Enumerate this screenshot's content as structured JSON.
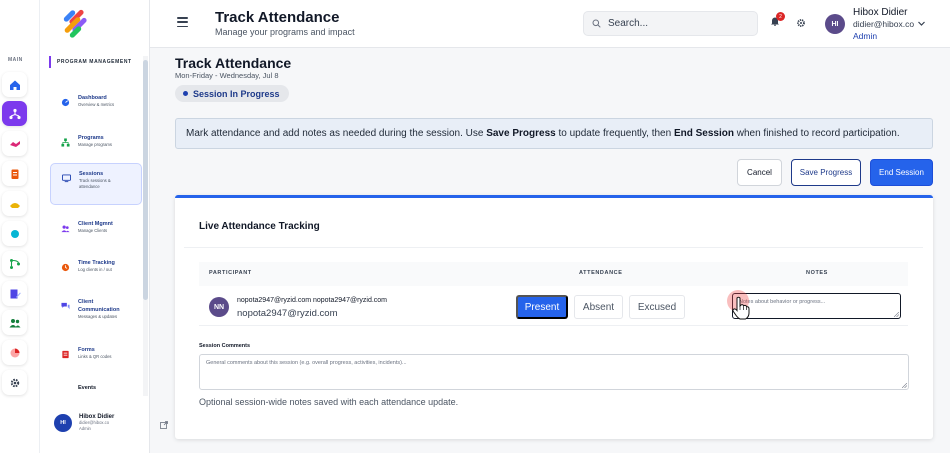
{
  "rail": {
    "label": "MAIN",
    "colors": {
      "active": "#7c3aed"
    },
    "items": [
      {
        "icon": "home-icon",
        "color": "#2563eb"
      },
      {
        "icon": "network-icon",
        "color": "#ffffff",
        "active": true
      },
      {
        "icon": "handshake-icon",
        "color": "#db2777"
      },
      {
        "icon": "clipboard-icon",
        "color": "#ea580c"
      },
      {
        "icon": "hands-icon",
        "color": "#eab308"
      },
      {
        "icon": "circle-icon",
        "color": "#06b6d4"
      },
      {
        "icon": "flow-icon",
        "color": "#16a34a"
      },
      {
        "icon": "edit-doc-icon",
        "color": "#4f46e5"
      },
      {
        "icon": "users-icon",
        "color": "#15803d"
      },
      {
        "icon": "pie-chart-icon",
        "color": "#dc2626"
      },
      {
        "icon": "gear-icon",
        "color": "#374151"
      }
    ]
  },
  "sidebar": {
    "section": "PROGRAM MANAGEMENT",
    "items": [
      {
        "title": "Dashboard",
        "sub": "Overview & metrics",
        "icon": "dashboard-icon",
        "color": "#2563eb"
      },
      {
        "title": "Programs",
        "sub": "Manage programs",
        "icon": "sitemap-icon",
        "color": "#16a34a"
      },
      {
        "title": "Sessions",
        "sub": "Track sessions & attendance",
        "icon": "monitor-icon",
        "color": "#1e40af",
        "active": true
      },
      {
        "title": "Client Mgmnt",
        "sub": "Manage Clients",
        "icon": "users-icon",
        "color": "#7c3aed"
      },
      {
        "title": "Time Tracking",
        "sub": "Log clients in / out",
        "icon": "clock-icon",
        "color": "#ea580c"
      },
      {
        "title": "Client Communication",
        "sub": "Messages & updates",
        "icon": "chat-icon",
        "color": "#4f46e5"
      },
      {
        "title": "Forms",
        "sub": "Links & QR codes",
        "icon": "form-icon",
        "color": "#dc2626"
      },
      {
        "title": "Events",
        "sub": "",
        "icon": "",
        "color": "#111827"
      }
    ],
    "footer": {
      "initials": "HI",
      "name": "Hibox Didier",
      "email": "didier@hibox.co",
      "role": "Admin"
    }
  },
  "header": {
    "title": "Track Attendance",
    "subtitle": "Manage your programs and impact",
    "search_placeholder": "Search...",
    "notification_count": "2",
    "user": {
      "initials": "HI",
      "name": "Hibox Didier",
      "email": "didier@hibox.co",
      "role": "Admin"
    }
  },
  "page": {
    "title": "Track Attendance",
    "date": "Mon-Friday - Wednesday, Jul 8",
    "status": "Session In Progress",
    "info": {
      "p1": "Mark attendance and add notes as needed during the session. Use ",
      "b1": "Save Progress",
      "p2": " to update frequently, then ",
      "b2": "End Session",
      "p3": " when finished to record participation."
    },
    "buttons": {
      "cancel": "Cancel",
      "save": "Save Progress",
      "end": "End Session"
    }
  },
  "card": {
    "title": "Live Attendance Tracking",
    "columns": {
      "participant": "PARTICIPANT",
      "attendance": "ATTENDANCE",
      "notes": "NOTES"
    },
    "rows": [
      {
        "initials": "NN",
        "name_line": "nopota2947@ryzid.com nopota2947@ryzid.com",
        "email": "nopota2947@ryzid.com",
        "options": {
          "present": "Present",
          "absent": "Absent",
          "excused": "Excused"
        },
        "selected": "Present",
        "notes_placeholder": "Notes about behavior or progress..."
      }
    ],
    "session_comments": {
      "label": "Session Comments",
      "placeholder": "General comments about this session (e.g. overall progress, activities, incidents)...",
      "help": "Optional session-wide notes saved with each attendance update."
    }
  },
  "colors": {
    "primary": "#2563eb",
    "brand_purple": "#7c3aed",
    "navy": "#1e3a8a"
  }
}
